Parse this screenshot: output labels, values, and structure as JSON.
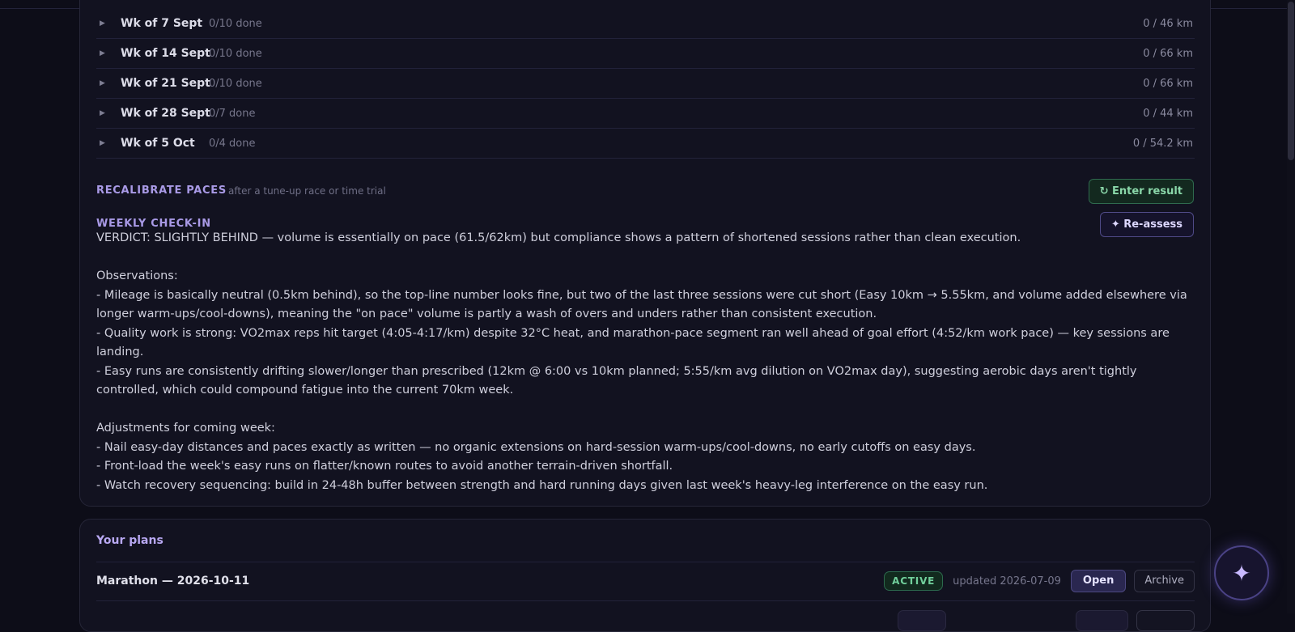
{
  "weeks": [
    {
      "title": "Wk of 7 Sept",
      "done": "0/10 done",
      "km": "0 / 46 km"
    },
    {
      "title": "Wk of 14 Sept",
      "done": "0/10 done",
      "km": "0 / 66 km"
    },
    {
      "title": "Wk of 21 Sept",
      "done": "0/10 done",
      "km": "0 / 66 km"
    },
    {
      "title": "Wk of 28 Sept",
      "done": "0/7 done",
      "km": "0 / 44 km"
    },
    {
      "title": "Wk of 5 Oct",
      "done": "0/4 done",
      "km": "0 / 54.2 km"
    }
  ],
  "recalibrate": {
    "label": "RECALIBRATE PACES",
    "sub": "after a tune-up race or time trial",
    "button": "↻ Enter result"
  },
  "checkin": {
    "label": "WEEKLY CHECK-IN",
    "button": "✦ Re-assess",
    "verdict": "VERDICT: SLIGHTLY BEHIND — volume is essentially on pace (61.5/62km) but compliance shows a pattern of shortened sessions rather than clean execution.",
    "observations_heading": "Observations:",
    "observations": [
      "- Mileage is basically neutral (0.5km behind), so the top-line number looks fine, but two of the last three sessions were cut short (Easy 10km → 5.55km, and volume added elsewhere via longer warm-ups/cool-downs), meaning the \"on pace\" volume is partly a wash of overs and unders rather than consistent execution.",
      "- Quality work is strong: VO2max reps hit target (4:05-4:17/km) despite 32°C heat, and marathon-pace segment ran well ahead of goal effort (4:52/km work pace) — key sessions are landing.",
      "- Easy runs are consistently drifting slower/longer than prescribed (12km @ 6:00 vs 10km planned; 5:55/km avg dilution on VO2max day), suggesting aerobic days aren't tightly controlled, which could compound fatigue into the current 70km week."
    ],
    "adjustments_heading": "Adjustments for coming week:",
    "adjustments": [
      "- Nail easy-day distances and paces exactly as written — no organic extensions on hard-session warm-ups/cool-downs, no early cutoffs on easy days.",
      "- Front-load the week's easy runs on flatter/known routes to avoid another terrain-driven shortfall.",
      "- Watch recovery sequencing: build in 24-48h buffer between strength and hard running days given last week's heavy-leg interference on the easy run."
    ]
  },
  "plans": {
    "title": "Your plans",
    "items": [
      {
        "name": "Marathon — 2026-10-11",
        "status": "ACTIVE",
        "updated": "updated 2026-07-09",
        "open": "Open",
        "archive": "Archive"
      }
    ]
  },
  "fab": {
    "icon": "sparkle-icon",
    "glyph": "✦"
  }
}
